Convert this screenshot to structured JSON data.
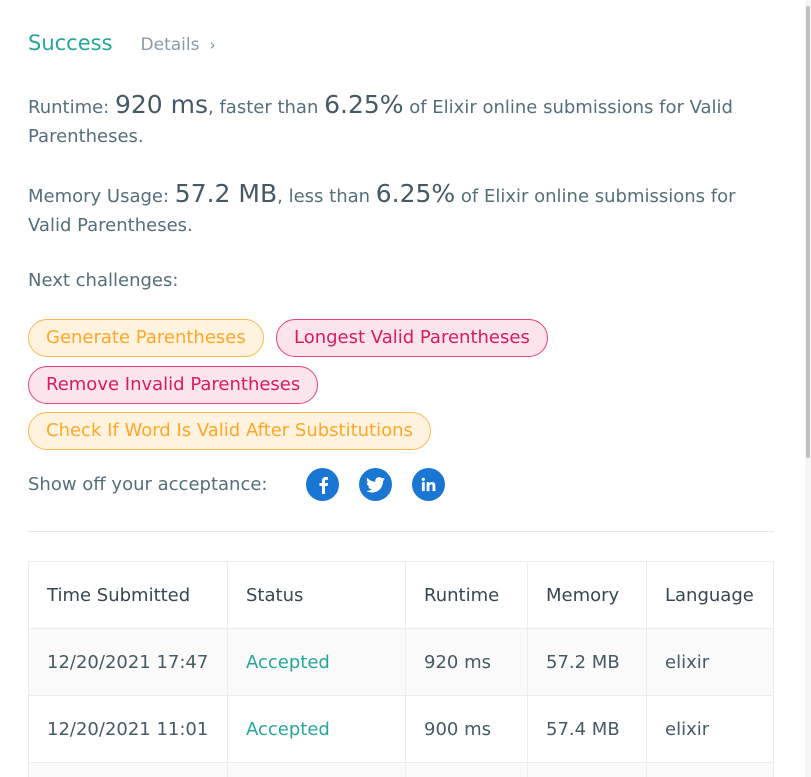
{
  "result": {
    "status": "Success",
    "details_label": "Details",
    "details_chevron": "›"
  },
  "runtime": {
    "label": "Runtime: ",
    "value": "920 ms",
    "compare": ", faster than ",
    "percent": "6.25%",
    "suffix": " of Elixir online submissions for Valid Parentheses."
  },
  "memory": {
    "label": "Memory Usage: ",
    "value": "57.2 MB",
    "compare": ", less than ",
    "percent": "6.25%",
    "suffix": " of Elixir online submissions for Valid Parentheses."
  },
  "next_challenges": {
    "title": "Next challenges:",
    "items": [
      {
        "label": "Generate Parentheses",
        "difficulty": "medium"
      },
      {
        "label": "Longest Valid Parentheses",
        "difficulty": "hard"
      },
      {
        "label": "Remove Invalid Parentheses",
        "difficulty": "hard"
      },
      {
        "label": "Check If Word Is Valid After Substitutions",
        "difficulty": "medium"
      }
    ]
  },
  "share": {
    "label": "Show off your acceptance:",
    "icons": [
      "facebook-icon",
      "twitter-icon",
      "linkedin-icon"
    ]
  },
  "submissions": {
    "headers": [
      "Time Submitted",
      "Status",
      "Runtime",
      "Memory",
      "Language"
    ],
    "rows": [
      {
        "time": "12/20/2021 17:47",
        "status": "Accepted",
        "runtime": "920 ms",
        "memory": "57.2 MB",
        "language": "elixir"
      },
      {
        "time": "12/20/2021 11:01",
        "status": "Accepted",
        "runtime": "900 ms",
        "memory": "57.4 MB",
        "language": "elixir"
      }
    ]
  },
  "colors": {
    "success": "#26a69a",
    "medium": "#ffa726",
    "hard": "#d81b60",
    "social": "#1976d2"
  }
}
